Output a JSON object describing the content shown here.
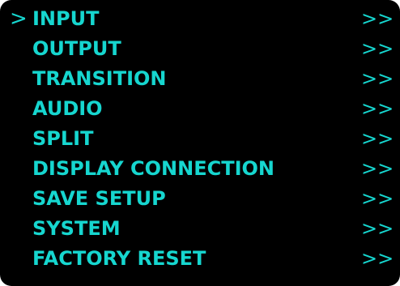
{
  "menu": {
    "cursor": ">",
    "items": [
      {
        "label": "INPUT",
        "arrow": ">>"
      },
      {
        "label": "OUTPUT",
        "arrow": ">>"
      },
      {
        "label": "TRANSITION",
        "arrow": ">>"
      },
      {
        "label": "AUDIO",
        "arrow": ">>"
      },
      {
        "label": "SPLIT",
        "arrow": ">>"
      },
      {
        "label": "DISPLAY CONNECTION",
        "arrow": ">>"
      },
      {
        "label": "SAVE SETUP",
        "arrow": ">>"
      },
      {
        "label": "SYSTEM",
        "arrow": ">>"
      },
      {
        "label": "FACTORY RESET",
        "arrow": ">>"
      }
    ]
  },
  "colors": {
    "text": "#16d6cf",
    "background": "#000000"
  }
}
